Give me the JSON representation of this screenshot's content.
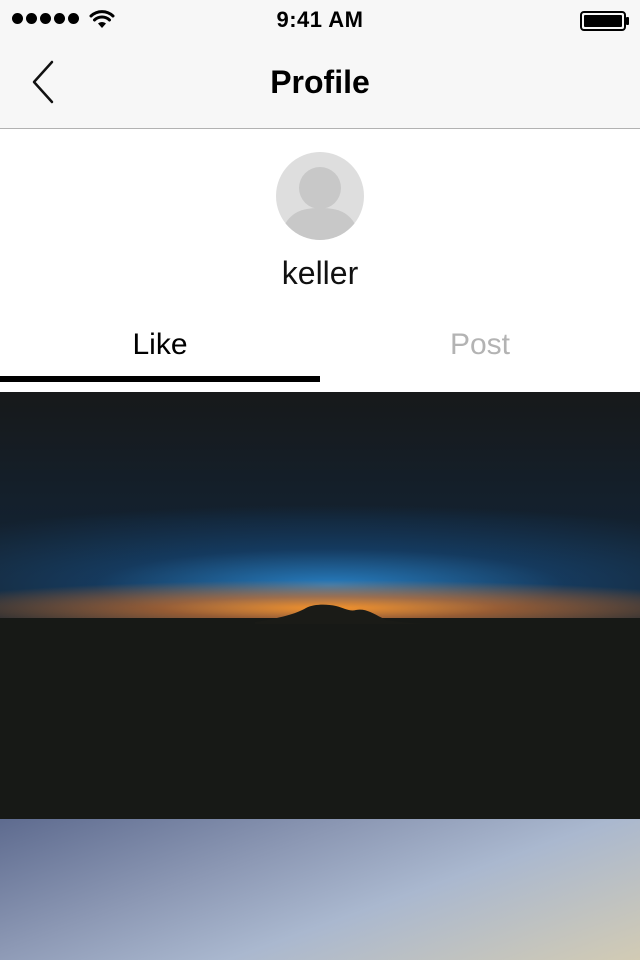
{
  "status_bar": {
    "time": "9:41 AM",
    "signal_icon": "signal-dots-icon",
    "wifi_icon": "wifi-icon",
    "battery_icon": "battery-full-icon"
  },
  "nav": {
    "title": "Profile",
    "back_icon": "chevron-left-icon"
  },
  "profile": {
    "avatar_icon": "default-avatar-icon",
    "username": "keller"
  },
  "tabs": [
    {
      "label": "Like",
      "active": true
    },
    {
      "label": "Post",
      "active": false
    }
  ],
  "feed": [
    {
      "type": "photo",
      "subject": "sunset horizon over dark landscape"
    },
    {
      "type": "photo",
      "subject": "pastel sky gradient"
    }
  ],
  "colors": {
    "nav_background": "#f7f7f7",
    "active_tab": "#000000",
    "inactive_tab": "#b3b3b3",
    "avatar_background": "#dedede",
    "avatar_silhouette": "#c8c8c8"
  }
}
